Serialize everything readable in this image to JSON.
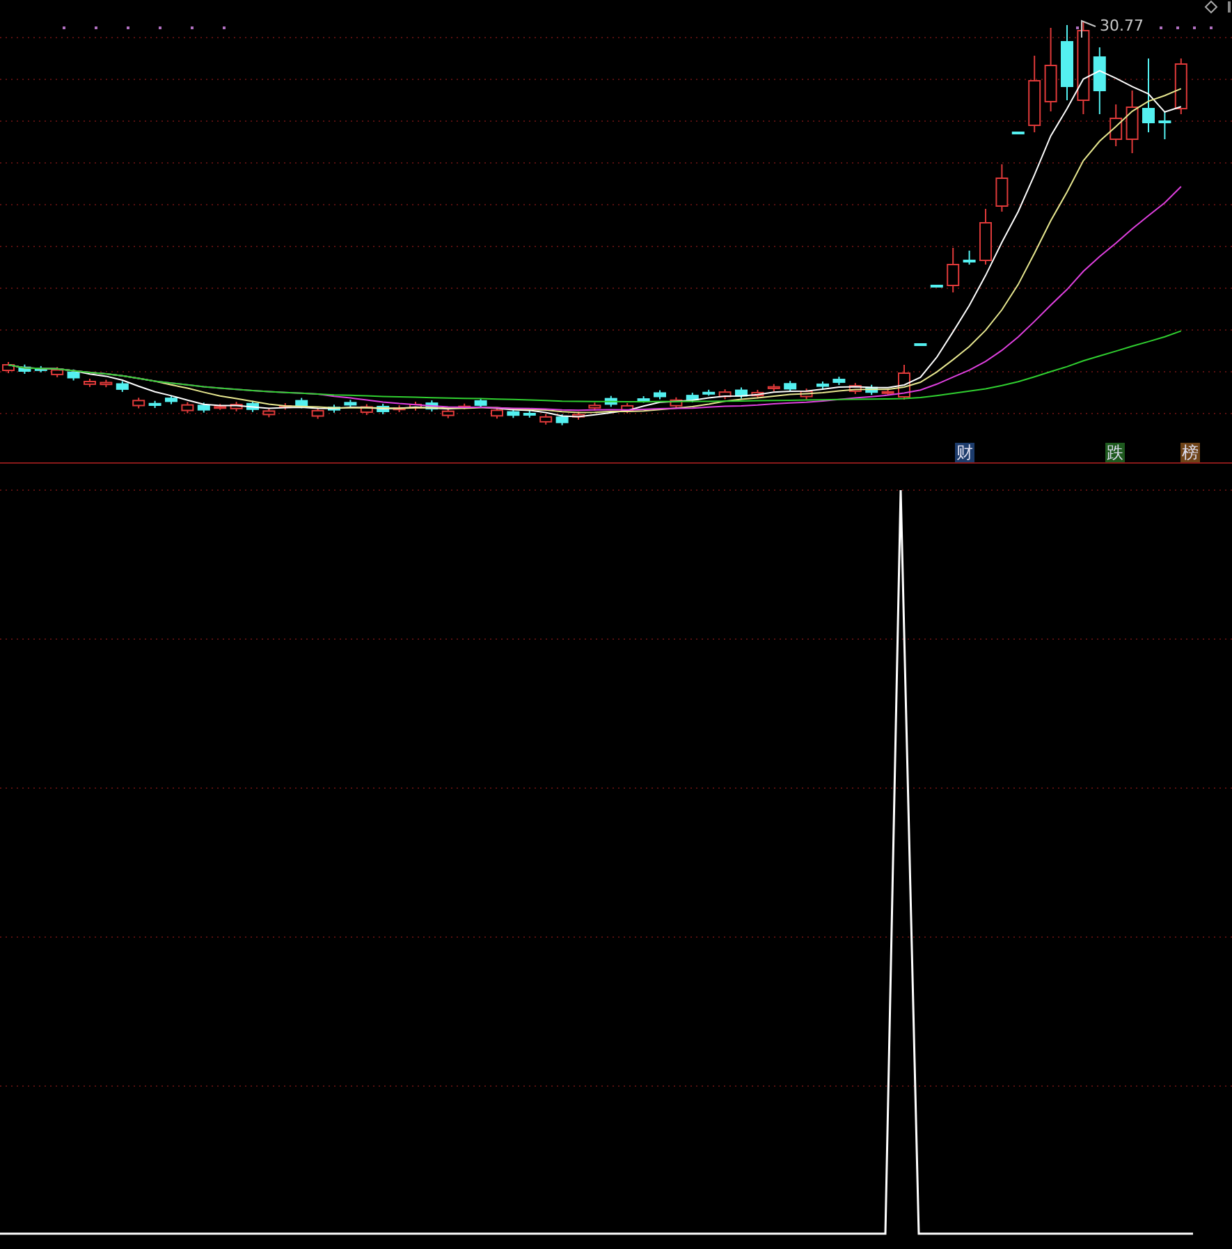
{
  "price_panel": {
    "high_label": "30.77",
    "tags": [
      {
        "text": "财",
        "color": "#1c3b6b"
      },
      {
        "text": "跌",
        "color": "#1e5a1e"
      },
      {
        "text": "榜",
        "color": "#6e4318"
      }
    ]
  }
}
